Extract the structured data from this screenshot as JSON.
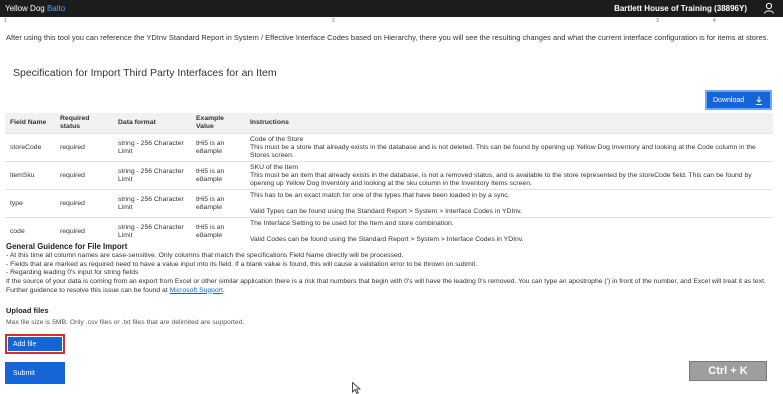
{
  "topbar": {
    "brand_prefix": "Yellow Dog",
    "brand_accent": "Balto",
    "org": "Bartlett House of Training (38896Y)"
  },
  "stepper": {
    "steps": [
      "1",
      "2",
      "3",
      "4"
    ]
  },
  "intro_text": "After using this tool you can reference the YDInv Standard Report in System / Effective Interface Codes based on Hierarchy, there you will see the resulting changes and what the current interface configuration is for items at stores.",
  "spec_title": "Specification for Import Third Party Interfaces for an Item",
  "download_label": "Download",
  "table": {
    "headers": {
      "field": "Field Name",
      "required": "Required status",
      "format": "Data format",
      "example": "Example Value",
      "instructions": "Instructions"
    },
    "rows": [
      {
        "field": "storeCode",
        "required": "required",
        "format": "string - 256 Character Limit",
        "example": "tHi5 is an e8ample",
        "instructions": "Code of the Store\nThis must be a store that already exists in the database and is not deleted. This can be found by opening up Yellow Dog Inventory and looking at the Code column in the Stores screen."
      },
      {
        "field": "itemSku",
        "required": "required",
        "format": "string - 256 Character Limit",
        "example": "tHi5 is an e8ample",
        "instructions": "SKU of the Item\nThis must be an item that already exists in the database, is not a removed status, and is available to the store represented by the storeCode field. This can be found by opening up Yellow Dog Inventory and looking at the sku column in the Inventory Items screen."
      },
      {
        "field": "type",
        "required": "required",
        "format": "string - 256 Character Limit",
        "example": "tHi5 is an e8ample",
        "instructions": "This has to be an exact match for one of the types that have been loaded in by a sync.\n\nValid Types can be found using the Standard Report > System > Interface Codes in YDInv."
      },
      {
        "field": "code",
        "required": "required",
        "format": "string - 256 Character Limit",
        "example": "tHi5 is an e8ample",
        "instructions": "The Interface Setting to be used for the Item and store combination.\n\nValid Codes can be found using the Standard Report > System > Interface Codes in YDInv."
      }
    ]
  },
  "guidance": {
    "title": "General Guidence for File Import",
    "line1": "- At this time all column names are case-sensitive. Only columns that match the specifications Field Name directly will be processed.",
    "line2": "- Fields that are marked as required need to have a value input into its field. If a blank value is found, this will cause a validation error to be thrown on submit.",
    "line3": "- Regarding leading 0's input for string fields",
    "line4": "If the source of your data is coming from an export from Excel or other similar application there is a risk that numbers that begin with 0's will have the leading 0's removed. You can type an apostrophe (') in front of the number, and Excel will treat it as text. Further guidence to resolve this issue can be found at ",
    "link": "Microsoft Support",
    "line4_end": "."
  },
  "upload": {
    "title": "Upload files",
    "hint": "Max file size is 5MB. Only .csv files or .txt files that are delimited are supported.",
    "add_label": "Add file",
    "submit_label": "Submit"
  },
  "shortcut_badge": "Ctrl + K",
  "colors": {
    "primary": "#1565d8",
    "topbar": "#1c1c1c",
    "highlight": "#d32f2f"
  },
  "icons": [
    "user-icon",
    "download-icon",
    "mouse-cursor-icon"
  ]
}
